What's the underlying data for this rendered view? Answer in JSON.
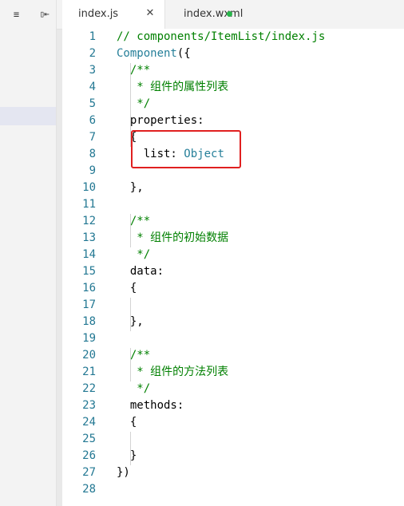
{
  "toolbar": {
    "icons": [
      "list-collapse-icon",
      "panel-toggle-icon"
    ],
    "left_glyph": "≡",
    "right_glyph": "▯⇤"
  },
  "tabs": [
    {
      "label": "index.js",
      "active": true,
      "close_glyph": "✕"
    },
    {
      "label": "index.wxml",
      "active": false,
      "modified": true
    }
  ],
  "colors": {
    "comment": "#008000",
    "line_number": "#237893",
    "type": "#267f99",
    "highlight_border": "#e02020",
    "modified_dot": "#28b64b"
  },
  "editor": {
    "lines": [
      {
        "n": "1",
        "tokens": [
          {
            "t": "// components/ItemList/index.js",
            "c": "comment"
          }
        ]
      },
      {
        "n": "2",
        "tokens": [
          {
            "t": "Component",
            "c": "fn"
          },
          {
            "t": "({",
            "c": "plain"
          }
        ]
      },
      {
        "n": "3",
        "tokens": [
          {
            "t": "  /**",
            "c": "comment"
          }
        ]
      },
      {
        "n": "4",
        "tokens": [
          {
            "t": "   * 组件的属性列表",
            "c": "comment"
          }
        ]
      },
      {
        "n": "5",
        "tokens": [
          {
            "t": "   */",
            "c": "comment"
          }
        ]
      },
      {
        "n": "6",
        "tokens": [
          {
            "t": "  properties:",
            "c": "plain"
          }
        ]
      },
      {
        "n": "7",
        "tokens": [
          {
            "t": "  {",
            "c": "plain"
          }
        ]
      },
      {
        "n": "8",
        "tokens": [
          {
            "t": "    list: ",
            "c": "plain"
          },
          {
            "t": "Object",
            "c": "type"
          }
        ]
      },
      {
        "n": "9",
        "tokens": [
          {
            "t": "",
            "c": "plain"
          }
        ]
      },
      {
        "n": "10",
        "tokens": [
          {
            "t": "  },",
            "c": "plain"
          }
        ]
      },
      {
        "n": "11",
        "tokens": [
          {
            "t": "",
            "c": "plain"
          }
        ]
      },
      {
        "n": "12",
        "tokens": [
          {
            "t": "  /**",
            "c": "comment"
          }
        ]
      },
      {
        "n": "13",
        "tokens": [
          {
            "t": "   * 组件的初始数据",
            "c": "comment"
          }
        ]
      },
      {
        "n": "14",
        "tokens": [
          {
            "t": "   */",
            "c": "comment"
          }
        ]
      },
      {
        "n": "15",
        "tokens": [
          {
            "t": "  data:",
            "c": "plain"
          }
        ]
      },
      {
        "n": "16",
        "tokens": [
          {
            "t": "  {",
            "c": "plain"
          }
        ]
      },
      {
        "n": "17",
        "tokens": [
          {
            "t": "",
            "c": "plain"
          }
        ]
      },
      {
        "n": "18",
        "tokens": [
          {
            "t": "  },",
            "c": "plain"
          }
        ]
      },
      {
        "n": "19",
        "tokens": [
          {
            "t": "",
            "c": "plain"
          }
        ]
      },
      {
        "n": "20",
        "tokens": [
          {
            "t": "  /**",
            "c": "comment"
          }
        ]
      },
      {
        "n": "21",
        "tokens": [
          {
            "t": "   * 组件的方法列表",
            "c": "comment"
          }
        ]
      },
      {
        "n": "22",
        "tokens": [
          {
            "t": "   */",
            "c": "comment"
          }
        ]
      },
      {
        "n": "23",
        "tokens": [
          {
            "t": "  methods:",
            "c": "plain"
          }
        ]
      },
      {
        "n": "24",
        "tokens": [
          {
            "t": "  {",
            "c": "plain"
          }
        ]
      },
      {
        "n": "25",
        "tokens": [
          {
            "t": "",
            "c": "plain"
          }
        ]
      },
      {
        "n": "26",
        "tokens": [
          {
            "t": "  }",
            "c": "plain"
          }
        ]
      },
      {
        "n": "27",
        "tokens": [
          {
            "t": "})",
            "c": "plain"
          }
        ]
      },
      {
        "n": "28",
        "tokens": [
          {
            "t": "",
            "c": "plain"
          }
        ]
      }
    ]
  }
}
